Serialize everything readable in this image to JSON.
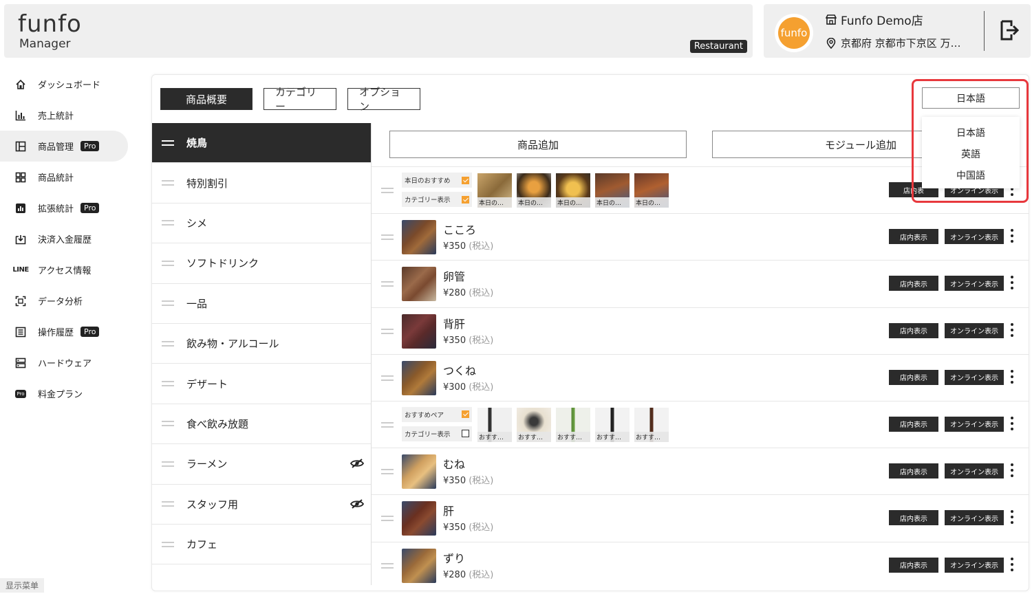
{
  "header": {
    "logo_top": "funfo",
    "logo_bottom": "Manager",
    "badge": "Restaurant",
    "avatar_text": "funfo",
    "store_name": "Funfo Demo店",
    "store_address": "京都府 京都市下京区 万…"
  },
  "sidebar": {
    "items": [
      {
        "label": "ダッシュボード",
        "icon": "home-icon"
      },
      {
        "label": "売上統計",
        "icon": "bar-chart-icon"
      },
      {
        "label": "商品管理",
        "icon": "layout-icon",
        "pro": "Pro"
      },
      {
        "label": "商品統計",
        "icon": "grid-icon"
      },
      {
        "label": "拡張統計",
        "icon": "chart-box-icon",
        "pro": "Pro"
      },
      {
        "label": "決済入金履歴",
        "icon": "deposit-icon"
      },
      {
        "label": "アクセス情報",
        "icon": "line-icon",
        "icon_text": "LINE"
      },
      {
        "label": "データ分析",
        "icon": "scan-icon"
      },
      {
        "label": "操作履歴",
        "icon": "list-icon",
        "pro": "Pro"
      },
      {
        "label": "ハードウェア",
        "icon": "server-icon"
      },
      {
        "label": "料金プラン",
        "icon": "pro-plan-icon",
        "icon_text": "Pro"
      }
    ],
    "footer": "显示菜单"
  },
  "tabs": [
    "商品概要",
    "カテゴリー",
    "オプション"
  ],
  "language": {
    "selected": "日本語",
    "options": [
      "日本語",
      "英語",
      "中国語"
    ]
  },
  "categories": [
    {
      "label": "焼鳥"
    },
    {
      "label": "特別割引"
    },
    {
      "label": "シメ"
    },
    {
      "label": "ソフトドリンク"
    },
    {
      "label": "一品"
    },
    {
      "label": "飲み物・アルコール"
    },
    {
      "label": "デザート"
    },
    {
      "label": "食べ飲み放題"
    },
    {
      "label": "ラーメン",
      "hidden": true
    },
    {
      "label": "スタッフ用",
      "hidden": true
    },
    {
      "label": "カフェ"
    }
  ],
  "actions": {
    "add_product": "商品追加",
    "add_module": "モジュール追加"
  },
  "tags": {
    "store": "店内表示",
    "store_partial": "店内表",
    "online": "オンライン表示"
  },
  "module1": {
    "label1": "本日のおすすめ",
    "label2": "カテゴリー表示",
    "thumbs": [
      "本日の…",
      "本日の…",
      "本日の…",
      "本日の…",
      "本日の…"
    ]
  },
  "module2": {
    "label1": "おすすめペア",
    "label2": "カテゴリー表示",
    "thumbs": [
      "おすす…",
      "おすす…",
      "おすす…",
      "おすす…",
      "おすす…"
    ]
  },
  "products": [
    {
      "name": "こころ",
      "price": "¥350",
      "tax": "(税込)"
    },
    {
      "name": "卵管",
      "price": "¥280",
      "tax": "(税込)"
    },
    {
      "name": "背肝",
      "price": "¥350",
      "tax": "(税込)"
    },
    {
      "name": "つくね",
      "price": "¥300",
      "tax": "(税込)"
    },
    {
      "name": "むね",
      "price": "¥350",
      "tax": "(税込)"
    },
    {
      "name": "肝",
      "price": "¥350",
      "tax": "(税込)"
    },
    {
      "name": "ずり",
      "price": "¥280",
      "tax": "(税込)"
    }
  ],
  "colors": {
    "accent": "#f5a030",
    "dark": "#2b2b2b",
    "highlight": "#e8383d"
  }
}
